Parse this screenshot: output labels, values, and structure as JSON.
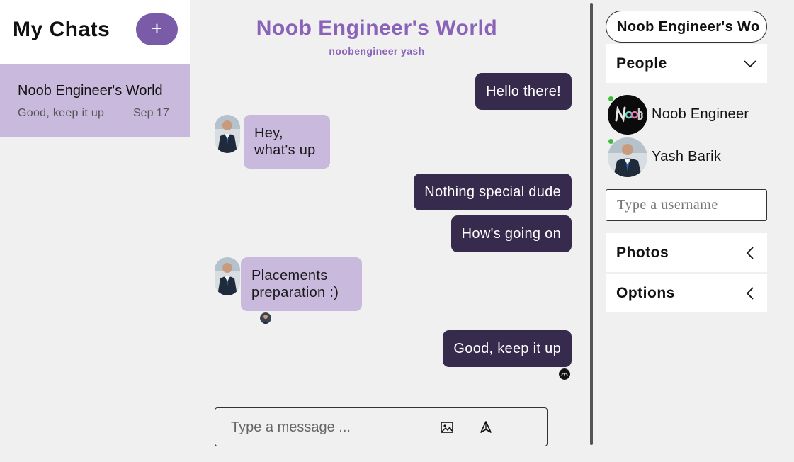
{
  "sidebar": {
    "title": "My Chats",
    "new_chat_label": "+",
    "chats": [
      {
        "title": "Noob Engineer's World",
        "last_message": "Good, keep it up",
        "date": "Sep 17"
      }
    ]
  },
  "feed": {
    "title": "Noob Engineer's World",
    "subtitle": "noobengineer yash",
    "messages": [
      {
        "from": "me",
        "text": "Hello there!"
      },
      {
        "from": "them",
        "text": "Hey, what's up"
      },
      {
        "from": "me",
        "text": "Nothing special dude"
      },
      {
        "from": "me",
        "text": "How's going on"
      },
      {
        "from": "them",
        "text": "Placements preparation :)"
      },
      {
        "from": "me",
        "text": "Good, keep it up"
      }
    ],
    "composer_placeholder": "Type a message ..."
  },
  "settings": {
    "chat_title_value": "Noob Engineer's World",
    "people_label": "People",
    "people": [
      {
        "name": "Noob Engineer",
        "online": true,
        "avatar": "noob-logo-avatar"
      },
      {
        "name": "Yash Barik",
        "online": true,
        "avatar": "suit-man-avatar"
      }
    ],
    "username_placeholder": "Type a username",
    "photos_label": "Photos",
    "options_label": "Options"
  },
  "colors": {
    "accent": "#7a5ba8",
    "title_purple": "#8a63b9",
    "my_bubble": "#362a4d",
    "their_bubble": "#c9b9dd",
    "online": "#3dbb3d"
  }
}
